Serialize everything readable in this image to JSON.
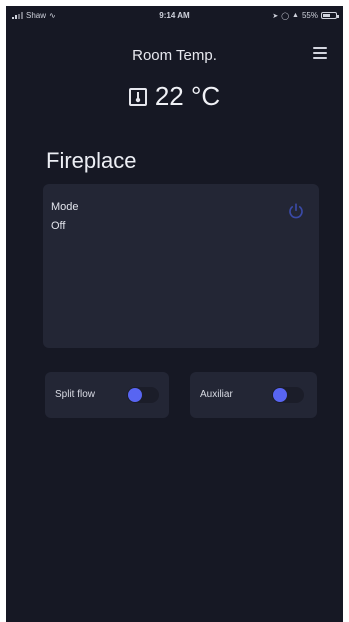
{
  "status_bar": {
    "carrier": "Shaw",
    "time": "9:14 AM",
    "battery": "55%",
    "battery_level": 0.55,
    "icons": [
      "signal-bars-icon",
      "wifi-icon",
      "location-arrow-icon",
      "alarm-icon",
      "bluetooth-icon",
      "battery-icon"
    ]
  },
  "header": {
    "title": "Room Temp.",
    "menu_icon": "hamburger-menu-icon"
  },
  "temperature": {
    "icon": "thermometer-icon",
    "value": "22 °C"
  },
  "device": {
    "name": "Fireplace",
    "mode_label": "Mode",
    "mode_value": "Off",
    "power_icon": "power-icon"
  },
  "toggles": [
    {
      "label": "Split flow",
      "on": false
    },
    {
      "label": "Auxiliar",
      "on": false
    }
  ],
  "colors": {
    "background": "#161824",
    "card": "#232635",
    "accent": "#5865f2",
    "text": "#e6e7ee",
    "toggle_track": "#1b1d29"
  }
}
